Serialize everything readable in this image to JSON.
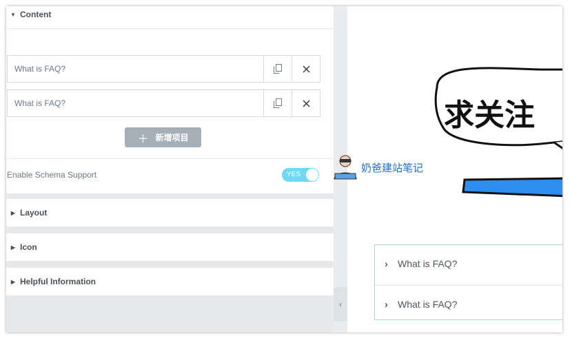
{
  "panel": {
    "content_label": "Content",
    "items": [
      {
        "title": "What is FAQ?"
      },
      {
        "title": "What is FAQ?"
      }
    ],
    "add_item_label": "新增项目",
    "schema_label": "Enable Schema Support",
    "schema_toggle": "YES",
    "sections": [
      "Layout",
      "Icon",
      "Helpful Information"
    ]
  },
  "preview": {
    "bubble_text": "求关注",
    "faq": [
      "What is FAQ?",
      "What is FAQ?"
    ]
  },
  "watermark": "奶爸建站笔记",
  "colors": {
    "toggle_on": "#71d7f7",
    "add_button": "#a4afb7",
    "accent_bar": "#2e8ef0",
    "faq_border": "#a9d4e6",
    "watermark_text": "#1e6ec8"
  }
}
